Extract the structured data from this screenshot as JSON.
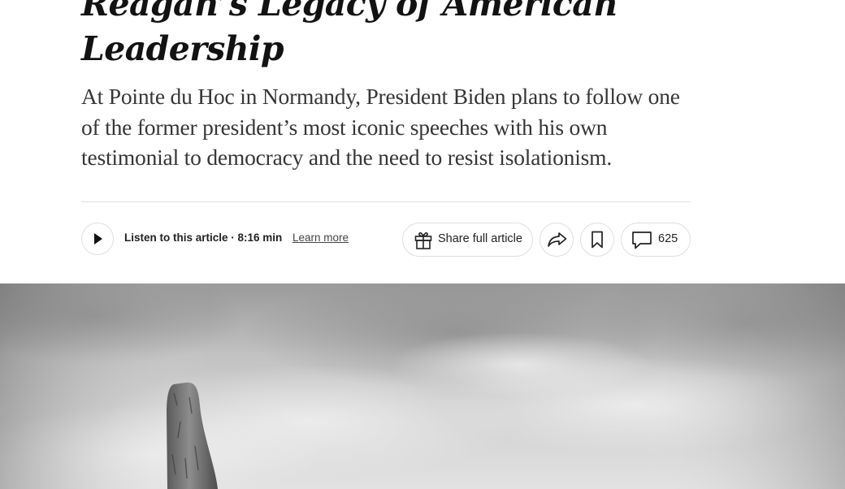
{
  "article": {
    "headline_line1": "Reagan’s Legacy of American",
    "headline_line2": "Leadership",
    "summary": "At Pointe du Hoc in Normandy, President Biden plans to follow one of the former president’s most iconic speeches with his own testimonial to democracy and the need to resist isolationism."
  },
  "toolbar": {
    "listen_label": "Listen to this article · 8:16 min",
    "learn_more": "Learn more",
    "share_full_label": "Share full article",
    "comment_count": "625"
  },
  "icons": {
    "play": "play-icon",
    "gift": "gift-icon",
    "share": "share-arrow-icon",
    "save": "bookmark-icon",
    "comment": "comment-bubble-icon"
  },
  "photo": {
    "style": "black-and-white",
    "subject": "stone monument against cloudy sky"
  },
  "colors": {
    "headline": "#121212",
    "summary": "#363636",
    "border": "#dfdfdf"
  }
}
